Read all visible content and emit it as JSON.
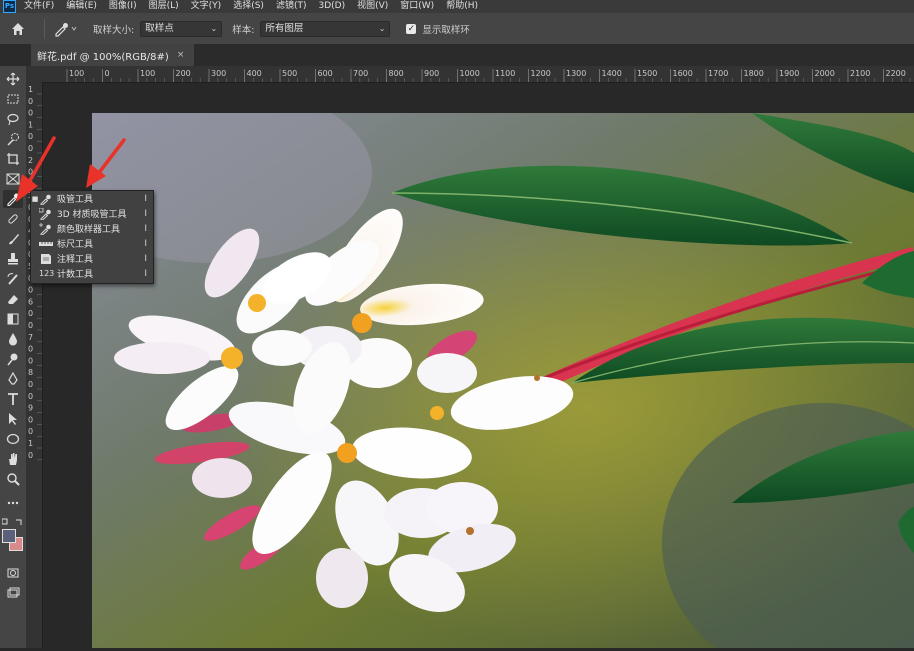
{
  "app": {
    "logo": "Ps"
  },
  "menu": [
    "文件(F)",
    "编辑(E)",
    "图像(I)",
    "图层(L)",
    "文字(Y)",
    "选择(S)",
    "滤镜(T)",
    "3D(D)",
    "视图(V)",
    "窗口(W)",
    "帮助(H)"
  ],
  "options": {
    "sample_size_label": "取样大小:",
    "sample_size_value": "取样点",
    "sample_label": "样本:",
    "sample_value": "所有图层",
    "show_ring_label": "显示取样环",
    "show_ring_checked": true
  },
  "document": {
    "tab_title": "鲜花.pdf @ 100%(RGB/8#)",
    "close": "×"
  },
  "ruler": {
    "h_ticks": [
      "100",
      "0",
      "100",
      "200",
      "300",
      "400",
      "500",
      "600",
      "700",
      "800",
      "900",
      "1000",
      "1100",
      "1200",
      "1300",
      "1400",
      "1500",
      "1600",
      "1700",
      "1800",
      "1900",
      "2000",
      "2100",
      "2200"
    ],
    "v_ticks": [
      "1",
      "0",
      "0",
      "1",
      "0",
      "0",
      "2",
      "0",
      "0",
      "3",
      "0",
      "0",
      "4",
      "0",
      "0",
      "5",
      "0",
      "0",
      "6",
      "0",
      "0",
      "7",
      "0",
      "0",
      "8",
      "0",
      "0",
      "9",
      "0",
      "0",
      "1",
      "0"
    ]
  },
  "flyout": [
    {
      "icon": "eyedropper-icon",
      "label": "吸管工具",
      "key": "I",
      "selected": true
    },
    {
      "icon": "3d-eyedropper-icon",
      "label": "3D 材质吸管工具",
      "key": "I",
      "selected": false
    },
    {
      "icon": "color-sampler-icon",
      "label": "颜色取样器工具",
      "key": "I",
      "selected": false
    },
    {
      "icon": "ruler-icon",
      "label": "标尺工具",
      "key": "I",
      "selected": false
    },
    {
      "icon": "note-icon",
      "label": "注释工具",
      "key": "I",
      "selected": false
    },
    {
      "icon": "count-icon",
      "label": "计数工具",
      "key": "I",
      "selected": false
    }
  ],
  "count_icon_text": "123",
  "toolbar_icons": [
    "move-icon",
    "marquee-icon",
    "lasso-icon",
    "quick-select-icon",
    "crop-icon",
    "frame-icon",
    "eyedropper-icon",
    "healing-icon",
    "brush-icon",
    "stamp-icon",
    "history-brush-icon",
    "eraser-icon",
    "gradient-icon",
    "blur-icon",
    "dodge-icon",
    "pen-icon",
    "type-icon",
    "path-select-icon",
    "shape-icon",
    "hand-icon",
    "zoom-icon",
    "more-icon"
  ],
  "colors": {
    "foreground": "#5a5f7a",
    "background": "#d98a8a",
    "accent": "#31a8ff",
    "annotation_arrow": "#e8322a"
  }
}
